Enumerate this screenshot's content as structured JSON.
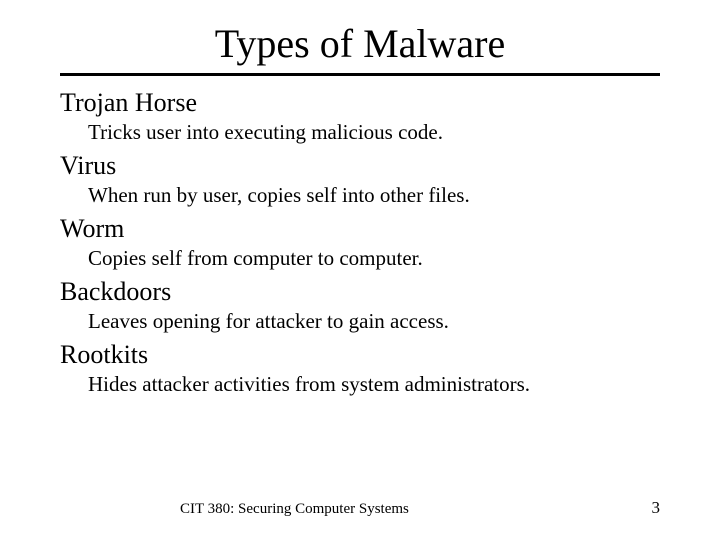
{
  "title": "Types of Malware",
  "items": [
    {
      "term": "Trojan Horse",
      "definition": "Tricks user into executing malicious code."
    },
    {
      "term": "Virus",
      "definition": "When run by user, copies self into other files."
    },
    {
      "term": "Worm",
      "definition": "Copies self from computer to computer."
    },
    {
      "term": "Backdoors",
      "definition": "Leaves opening for attacker to gain access."
    },
    {
      "term": "Rootkits",
      "definition": "Hides attacker activities from system administrators."
    }
  ],
  "footer": {
    "course": "CIT 380: Securing Computer Systems",
    "page": "3"
  }
}
